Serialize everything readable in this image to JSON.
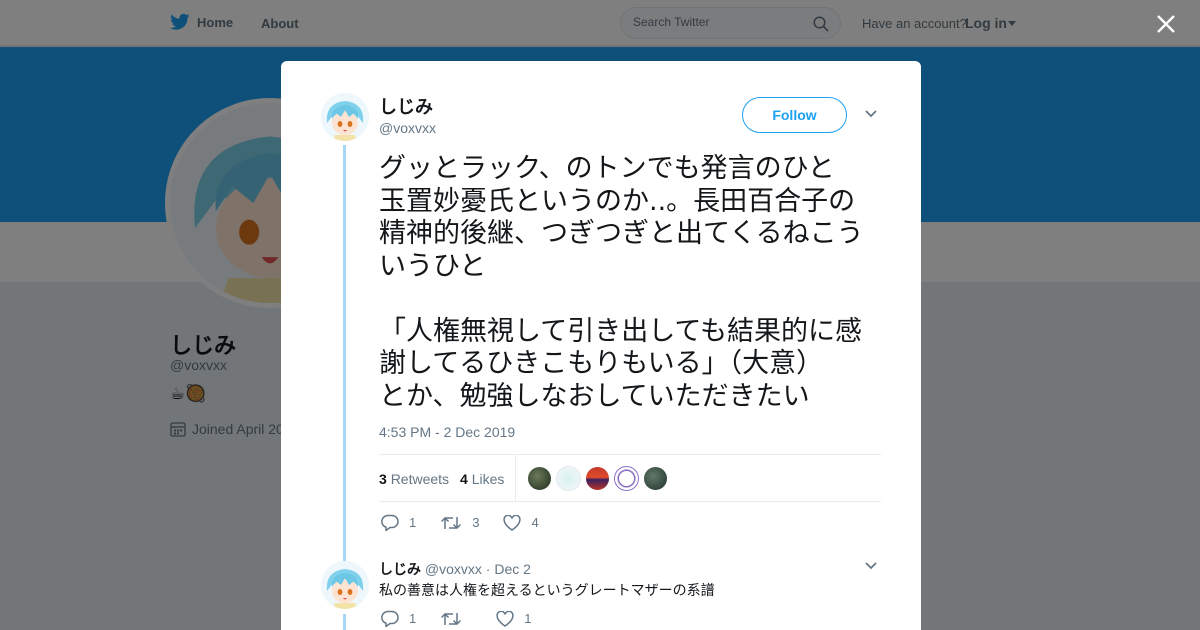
{
  "topbar": {
    "home_label": "Home",
    "about_label": "About",
    "search_placeholder": "Search Twitter",
    "account_prompt": "Have an account?",
    "login_label": "Log in"
  },
  "profile": {
    "name": "しじみ",
    "handle": "@voxvxx",
    "bio": "☕🥘",
    "joined": "Joined April 20"
  },
  "tweet": {
    "author_name": "しじみ",
    "author_handle": "@voxvxx",
    "follow_label": "Follow",
    "text": "グッとラック、のトンでも発言のひと\n玉置妙憂氏というのか..。長田百合子の\n精神的後継、つぎつぎと出てくるねこう\nいうひと\n\n「人権無視して引き出しても結果的に感\n謝してるひきこもりもいる」（大意）\nとか、勉強しなおしていただきたい",
    "timestamp": "4:53 PM - 2 Dec 2019",
    "retweets_count": "3",
    "retweets_label": "Retweets",
    "likes_count": "4",
    "likes_label": "Likes",
    "actions": {
      "replies": "1",
      "retweets": "3",
      "likes": "4"
    }
  },
  "reply": {
    "author_name": "しじみ",
    "author_handle": "@voxvxx",
    "date": "· Dec 2",
    "text": "私の善意は人権を超えるというグレートマザーの系譜",
    "actions": {
      "replies": "1",
      "retweets": "",
      "likes": "1"
    }
  },
  "colors": {
    "accent": "#1da1f2",
    "thread_line": "#a6d7f6",
    "muted_text": "#657786"
  }
}
